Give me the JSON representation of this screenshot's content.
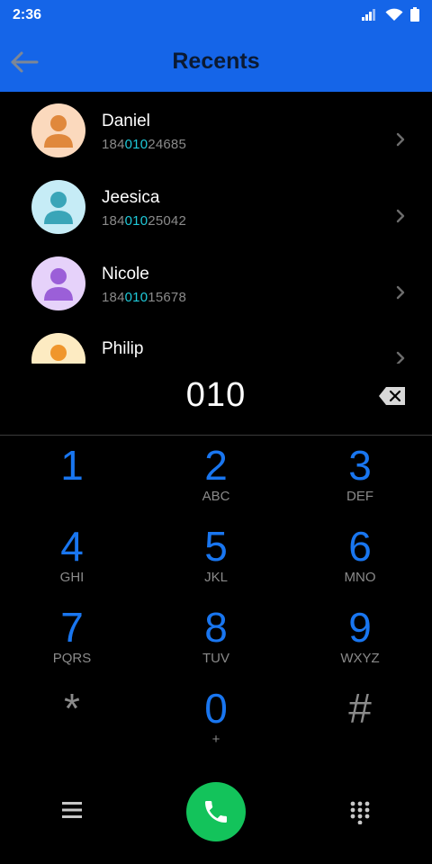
{
  "status_bar": {
    "time": "2:36",
    "icons": [
      "signal-icon",
      "wifi-icon",
      "battery-icon"
    ]
  },
  "app_bar": {
    "title": "Recents",
    "back_icon": "arrow-left-icon",
    "background": "#1565e8"
  },
  "contacts": [
    {
      "name": "Daniel",
      "number_prefix": "184",
      "number_match": "010",
      "number_suffix": "24685",
      "avatar_bg": "#fbd9bd",
      "avatar_fg": "#e0883c"
    },
    {
      "name": "Jeesica",
      "number_prefix": "184",
      "number_match": "010",
      "number_suffix": "25042",
      "avatar_bg": "#c6ecf6",
      "avatar_fg": "#3aa5b8"
    },
    {
      "name": "Nicole",
      "number_prefix": "184",
      "number_match": "010",
      "number_suffix": "15678",
      "avatar_bg": "#e6d2fa",
      "avatar_fg": "#9b5fd8"
    },
    {
      "name": "Philip",
      "number_prefix": "",
      "number_match": "",
      "number_suffix": "",
      "avatar_bg": "#fdebc2",
      "avatar_fg": "#f0962c"
    }
  ],
  "dial_entry": {
    "digits": "010",
    "backspace_icon": "backspace-icon"
  },
  "keypad": [
    {
      "digit": "1",
      "letters": ""
    },
    {
      "digit": "2",
      "letters": "ABC"
    },
    {
      "digit": "3",
      "letters": "DEF"
    },
    {
      "digit": "4",
      "letters": "GHI"
    },
    {
      "digit": "5",
      "letters": "JKL"
    },
    {
      "digit": "6",
      "letters": "MNO"
    },
    {
      "digit": "7",
      "letters": "PQRS"
    },
    {
      "digit": "8",
      "letters": "TUV"
    },
    {
      "digit": "9",
      "letters": "WXYZ"
    },
    {
      "digit": "*",
      "letters": ""
    },
    {
      "digit": "0",
      "letters": "+"
    },
    {
      "digit": "#",
      "letters": ""
    }
  ],
  "bottom_bar": {
    "menu_icon": "menu-icon",
    "call_icon": "phone-icon",
    "dialpad_icon": "dialpad-icon",
    "call_color": "#13c35b"
  },
  "colors": {
    "accent": "#1976f0",
    "match_highlight": "#1fc9d9",
    "secondary_text": "#8a8a8a"
  }
}
